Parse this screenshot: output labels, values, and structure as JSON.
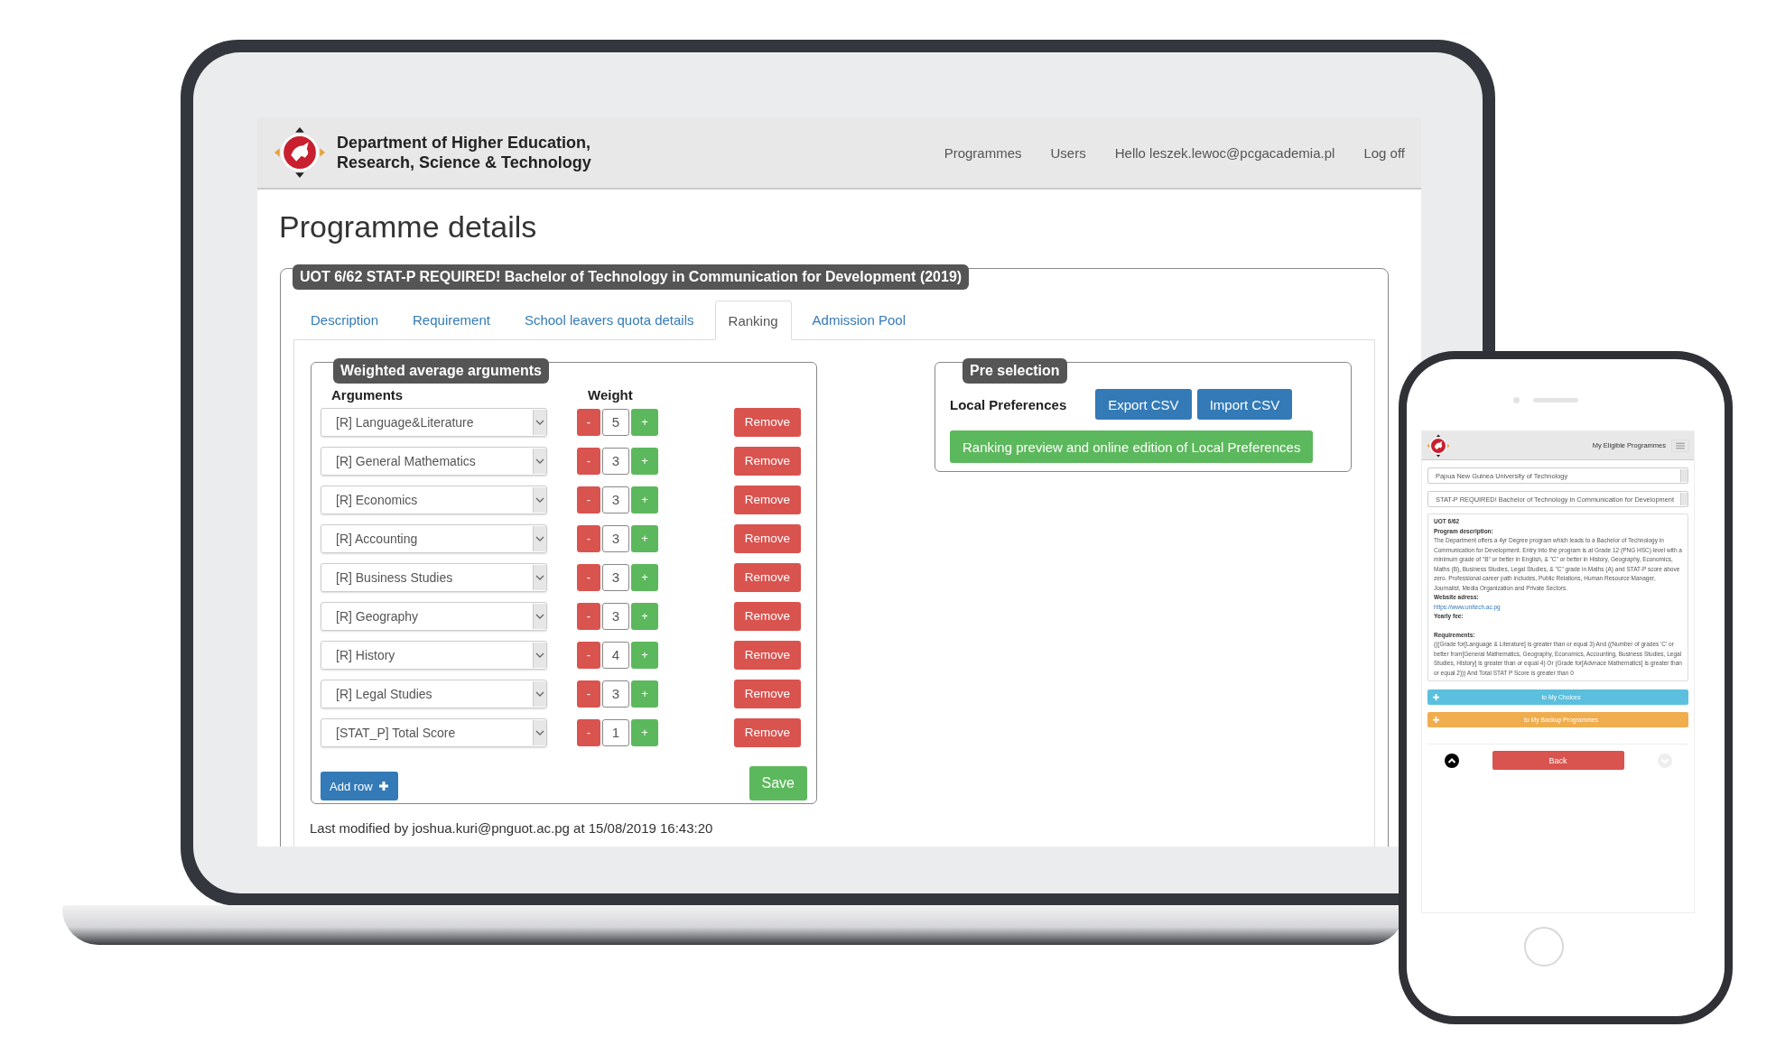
{
  "header": {
    "org_line1": "Department of Higher Education,",
    "org_line2": "Research, Science & Technology",
    "nav": [
      "Programmes",
      "Users",
      "Hello leszek.lewoc@pcgacademia.pl",
      "Log off"
    ]
  },
  "page_title": "Programme details",
  "programme": {
    "legend": "UOT 6/62 STAT-P REQUIRED! Bachelor of Technology in Communication for Development (2019)",
    "tabs": [
      {
        "label": "Description",
        "selected": false
      },
      {
        "label": "Requirement",
        "selected": false
      },
      {
        "label": "School leavers quota details",
        "selected": false
      },
      {
        "label": "Ranking",
        "selected": true
      },
      {
        "label": "Admission Pool",
        "selected": false
      }
    ],
    "weighted": {
      "legend": "Weighted average arguments",
      "col_arguments": "Arguments",
      "col_weight": "Weight",
      "rows": [
        {
          "argument": "[R] Language&Literature",
          "minus": "-",
          "weight": "5",
          "plus": "+",
          "remove": "Remove"
        },
        {
          "argument": "[R] General Mathematics",
          "minus": "-",
          "weight": "3",
          "plus": "+",
          "remove": "Remove"
        },
        {
          "argument": "[R] Economics",
          "minus": "-",
          "weight": "3",
          "plus": "+",
          "remove": "Remove"
        },
        {
          "argument": "[R] Accounting",
          "minus": "-",
          "weight": "3",
          "plus": "+",
          "remove": "Remove"
        },
        {
          "argument": "[R] Business Studies",
          "minus": "-",
          "weight": "3",
          "plus": "+",
          "remove": "Remove"
        },
        {
          "argument": "[R] Geography",
          "minus": "-",
          "weight": "3",
          "plus": "+",
          "remove": "Remove"
        },
        {
          "argument": "[R] History",
          "minus": "-",
          "weight": "4",
          "plus": "+",
          "remove": "Remove"
        },
        {
          "argument": "[R] Legal Studies",
          "minus": "-",
          "weight": "3",
          "plus": "+",
          "remove": "Remove"
        },
        {
          "argument": "[STAT_P] Total Score",
          "minus": "-",
          "weight": "1",
          "plus": "+",
          "remove": "Remove"
        }
      ],
      "add_row": "Add row",
      "save": "Save"
    },
    "preselection": {
      "legend": "Pre selection",
      "label": "Local Preferences",
      "export": "Export CSV",
      "import": "Import CSV",
      "ranking": "Ranking preview and online edition of Local Preferences"
    },
    "last_modified": "Last modified by joshua.kuri@pnguot.ac.pg at 15/08/2019 16:43:20"
  },
  "phone": {
    "nav_title": "My Eligible Programmes",
    "university": "Papua New Guinea University of Technology",
    "programme": "STAT-P REQUIRED! Bachelor of Technology in Communication for Development",
    "code": "UOT 6/62",
    "sections": [
      {
        "label": "Program description:",
        "text": "The Department offers a 4yr Degree program which leads to a Bachelor of Technology in Communication for Development. Entry into the program is at Grade 12 (PNG HSC) level with a minimum grade of \"B\" or better in English, & \"C\" or better in History, Geography, Economics, Maths (B), Business Studies, Legal Studies, & \"C\" grade in Maths (A) and STAT-P score above zero. Professional career path includes, Public Relations, Human Resource Manager, Journalist, Media Organization and Private Sectors."
      },
      {
        "label": "Website adress:",
        "link": "https://www.unitech.ac.pg"
      },
      {
        "label": "Yearly fee:"
      },
      {
        "label": "Requirements:",
        "text": "(((Grade for[Language & Literature] is greater than or equal 3) And ((Number of grades 'C' or better from[General Mathematics, Geography, Economics, Accounting, Business Studies, Legal Studies, History] is greater than or equal 4) Or (Grade for[Advnace Mathematics] is greater than or equal 2))) And Total STAT P Score is greater than 0"
      }
    ],
    "choices": "to My Choices",
    "backup": "to My Backup Programmes",
    "back": "Back"
  }
}
